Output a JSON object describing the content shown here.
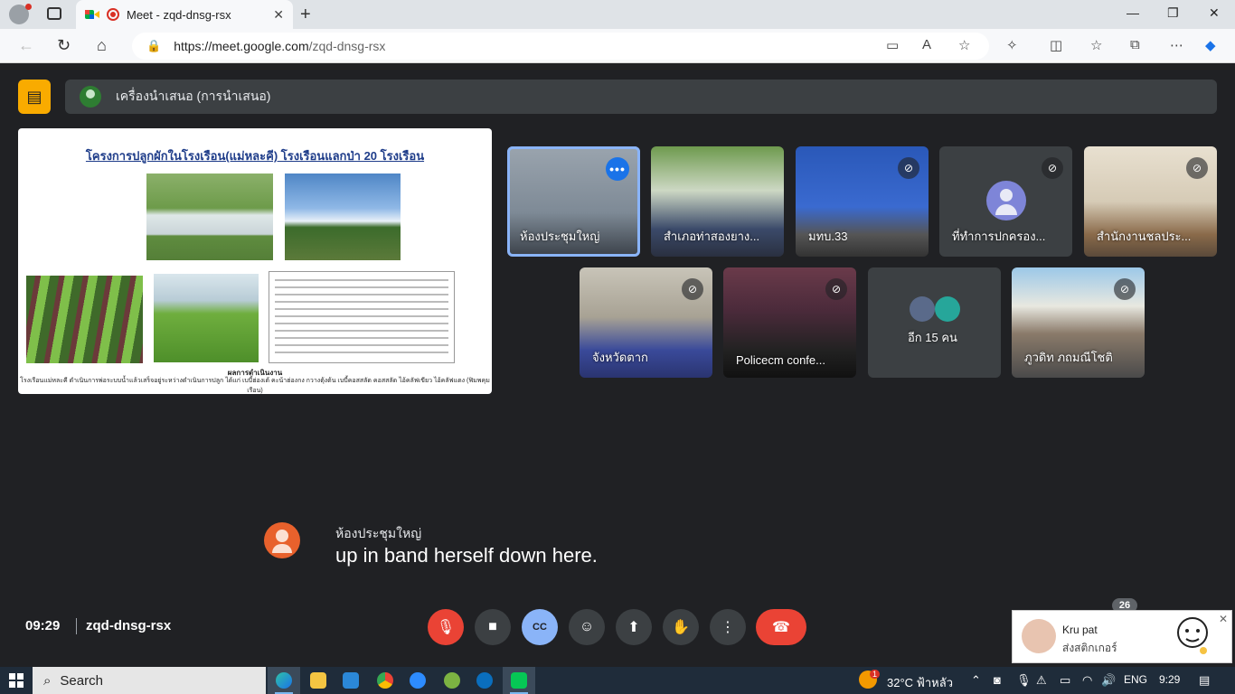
{
  "browser": {
    "tab_title": "Meet - zqd-dnsg-rsx",
    "url_host": "https://meet.google.com",
    "url_path": "/zqd-dnsg-rsx"
  },
  "meet": {
    "presenting_label": "เครื่องนำเสนอ (การนำเสนอ)",
    "slide": {
      "title": "โครงการปลูกผักในโรงเรือน(แม่หละคี) โรงเรือนแลกป่า 20 โรงเรือน",
      "result_heading": "ผลการดำเนินงาน",
      "result_text": "โรงเรือนแม่หละคี ดำเนินการพ่อระบบน้ำแล้วเสร็จอยู่ระหว่างดำเนินการปลูก ได้แก่ เบบี้ฮ่องเต้ คะน้าฮ่องกง กวางตุ้งต้น เบบี้คอสสลัด คอสสลัด ไอ้คลัฟเขียว ไอ้คลัฟแดง (ฟิมพคุมเรือน)"
    },
    "participants": [
      {
        "name": "ห้องประชุมใหญ่",
        "state": "active"
      },
      {
        "name": "สำเภอท่าสองยาง...",
        "state": "muted"
      },
      {
        "name": "มทบ.33",
        "state": "muted"
      },
      {
        "name": "ที่ทำการปกครอง...",
        "state": "muted"
      },
      {
        "name": "สำนักงานชลประ...",
        "state": "muted"
      },
      {
        "name": "จังหวัดตาก",
        "state": "muted"
      },
      {
        "name": "Policecm confe...",
        "state": "muted"
      },
      {
        "name": "อีก 15 คน",
        "state": "more"
      },
      {
        "name": "ภูวดิท ภถมณีโชติ",
        "state": "muted"
      }
    ],
    "caption": {
      "speaker": "ห้องประชุมใหญ่",
      "text": "up in band herself down here."
    },
    "time": "09:29",
    "meeting_code": "zqd-dnsg-rsx",
    "participant_count": "26"
  },
  "notification": {
    "name": "Kru pat",
    "message": "ส่งสติกเกอร์"
  },
  "taskbar": {
    "search_label": "Search",
    "weather": "32°C ฟ้าหลัว",
    "lang": "ENG",
    "clock": "9:29",
    "weather_badge": "1"
  },
  "colors": {
    "meet_bg": "#202124",
    "accent_blue": "#8ab4f8",
    "end_red": "#ea4335",
    "present_yellow": "#f9ab00"
  }
}
